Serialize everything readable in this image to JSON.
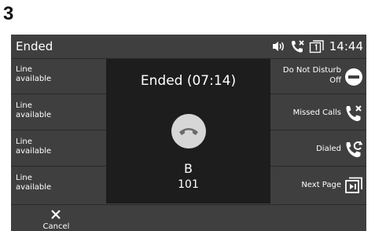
{
  "step_number": "3",
  "statusbar": {
    "title": "Ended",
    "time": "14:44",
    "icons": [
      "speaker-icon",
      "missed-call-icon",
      "page-icon"
    ]
  },
  "lines": [
    {
      "label": "Line\navailable"
    },
    {
      "label": "Line\navailable"
    },
    {
      "label": "Line\navailable"
    },
    {
      "label": "Line\navailable"
    }
  ],
  "call": {
    "status": "Ended  (07:14)",
    "contact_name": "B",
    "contact_number": "101"
  },
  "softkeys": {
    "do_not_disturb": "Do Not Disturb\nOff",
    "missed_calls": "Missed Calls",
    "dialed": "Dialed",
    "next_page": "Next Page"
  },
  "bottom": {
    "cancel": "Cancel"
  },
  "colors": {
    "screen_bg": "#3f3f3f",
    "center_bg": "#1d1d1d",
    "hangup_bg": "#d6d6d6",
    "text": "#ffffff"
  }
}
